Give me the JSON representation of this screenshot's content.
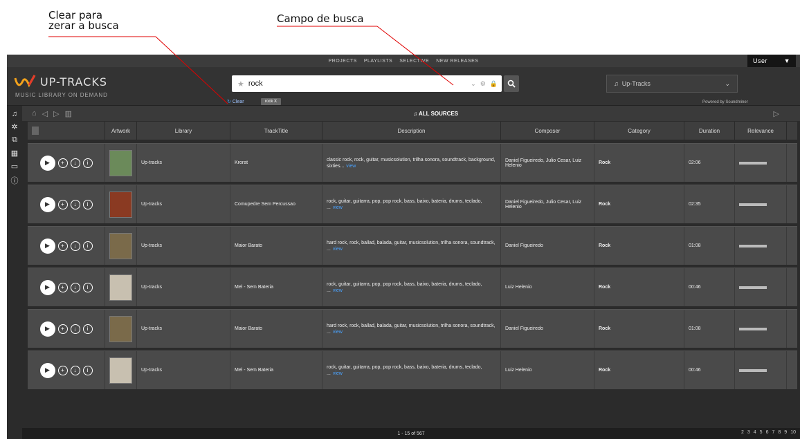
{
  "annotations": {
    "clear_note": "Clear para\nzerar a busca",
    "search_note": "Campo de busca"
  },
  "topnav": [
    "PROJECTS",
    "PLAYLISTS",
    "SELECTIVE",
    "NEW RELEASES"
  ],
  "user_menu": {
    "label": "User"
  },
  "brand": {
    "name": "UP-TRACKS",
    "tagline": "MUSIC LIBRARY ON DEMAND"
  },
  "search": {
    "value": "rock",
    "clear_label": "Clear",
    "chip": "rock X"
  },
  "source_select": {
    "selected": "Up-Tracks"
  },
  "powered_by": "Powered by Soundminer",
  "subbar": {
    "sources_label": "ALL SOURCES"
  },
  "columns": [
    "Artwork",
    "Library",
    "TrackTitle",
    "Description",
    "Composer",
    "Category",
    "Duration",
    "Relevance"
  ],
  "rows": [
    {
      "library": "Up-tracks",
      "title": "Krorat",
      "description": "classic rock, rock, guitar, musicsolution, trilha sonora, soundtrack, background, sixties...",
      "view": "view",
      "composer": "Daniel Figueiredo, Julio Cesar, Luiz Helenio",
      "category": "Rock",
      "duration": "02:06",
      "relevance": 1.0
    },
    {
      "library": "Up-tracks",
      "title": "Comupedre Sem Percussao",
      "description": "rock, guitar, guitarra, pop, pop rock, bass, baixo, bateria, drums, teclado, ...",
      "view": "view",
      "composer": "Daniel Figueiredo, Julio Cesar, Luiz Helenio",
      "category": "Rock",
      "duration": "02:35",
      "relevance": 1.0
    },
    {
      "library": "Up-tracks",
      "title": "Maior Barato",
      "description": "hard rock, rock, ballad, balada, guitar, musicsolution, trilha sonora, soundtrack, ...",
      "view": "view",
      "composer": "Daniel Figueiredo",
      "category": "Rock",
      "duration": "01:08",
      "relevance": 1.0
    },
    {
      "library": "Up-tracks",
      "title": "Mel - Sem Bateria",
      "description": "rock, guitar, guitarra, pop, pop rock, bass, baixo, bateria, drums, teclado, ...",
      "view": "view",
      "composer": "Luiz Helenio",
      "category": "Rock",
      "duration": "00:46",
      "relevance": 1.0
    },
    {
      "library": "Up-tracks",
      "title": "Maior Barato",
      "description": "hard rock, rock, ballad, balada, guitar, musicsolution, trilha sonora, soundtrack, ...",
      "view": "view",
      "composer": "Daniel Figueiredo",
      "category": "Rock",
      "duration": "01:08",
      "relevance": 1.0
    },
    {
      "library": "Up-tracks",
      "title": "Mel - Sem Bateria",
      "description": "rock, guitar, guitarra, pop, pop rock, bass, baixo, bateria, drums, teclado, ...",
      "view": "view",
      "composer": "Luiz Helenio",
      "category": "Rock",
      "duration": "00:46",
      "relevance": 1.0
    }
  ],
  "footer": {
    "count": "1 - 15 of 567",
    "pages": [
      "2",
      "3",
      "4",
      "5",
      "6",
      "7",
      "8",
      "9",
      "10"
    ]
  },
  "colors": {
    "accent": "#e53a2a",
    "link": "#4aa3ff",
    "annotation_line": "#e00000"
  }
}
